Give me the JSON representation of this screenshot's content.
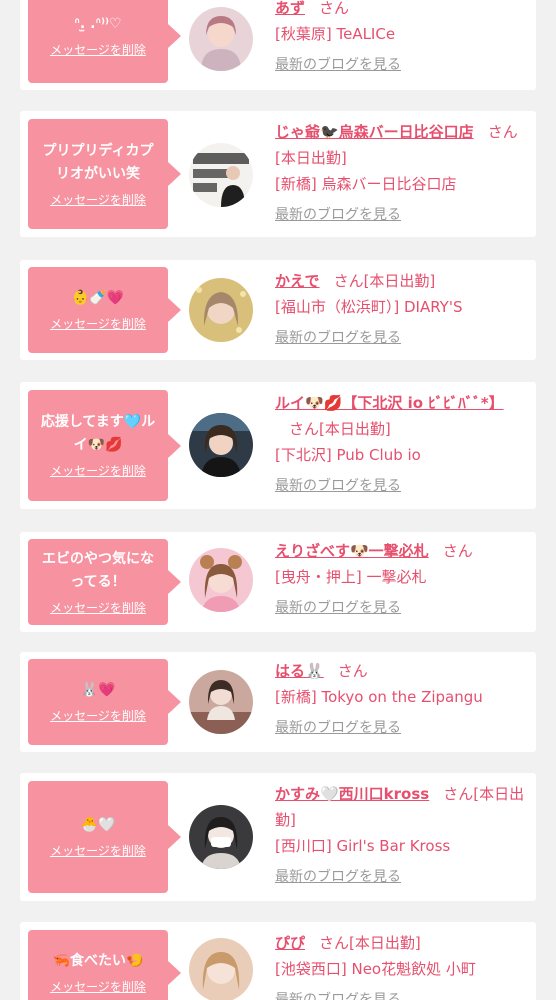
{
  "delete_label": "メッセージを削除",
  "blog_label": "最新のブログを見る",
  "san_label": "さん",
  "colors": {
    "accent": "#f792a0",
    "name": "#e6506e",
    "muted": "#9a9a9a"
  },
  "entries": [
    {
      "message": "ᐢ.̫ .ᐢ⁾⁾♡",
      "name": "あず",
      "status": "",
      "shop": "[秋葉原] TeALICe",
      "avatar_icon": "avatar-photo"
    },
    {
      "message": "プリプリディカプリオがいい笑",
      "name": "じゃ爺🐦‍⬛烏森バー日比谷口店",
      "status": "[本日出勤]",
      "shop": "[新橋] 烏森バー日比谷口店",
      "avatar_icon": "avatar-photo"
    },
    {
      "message": "👶🍼💗",
      "name": "かえで",
      "status": "[本日出勤]",
      "shop": "[福山市（松浜町）] DIARY'S",
      "avatar_icon": "avatar-photo"
    },
    {
      "message": "応援してます🩵ルイ🐶💋",
      "name": "ルイ🐶💋【下北沢 io ﾋﾞﾋﾞﾊﾞﾞ*】",
      "status": "[本日出勤]",
      "shop": "[下北沢] Pub Club io",
      "avatar_icon": "avatar-photo"
    },
    {
      "message": "エビのやつ気になってる！",
      "name": "えりざべす🐶一撃必札",
      "status": "",
      "shop": "[曳舟・押上] 一撃必札",
      "avatar_icon": "avatar-photo"
    },
    {
      "message": "🐰💗",
      "name": "はる🐰",
      "status": "",
      "shop": "[新橋] Tokyo on the Zipangu",
      "avatar_icon": "avatar-photo"
    },
    {
      "message": "🐣🤍",
      "name": "かすみ🤍西川口kross",
      "status": "[本日出勤]",
      "shop": "[西川口] Girl's Bar Kross",
      "avatar_icon": "avatar-photo"
    },
    {
      "message": "🦐食べたい🍤",
      "name": "ぴぴ",
      "status": "[本日出勤]",
      "shop": "[池袋西口] Neo花魁飲処 小町",
      "avatar_icon": "avatar-photo"
    }
  ]
}
